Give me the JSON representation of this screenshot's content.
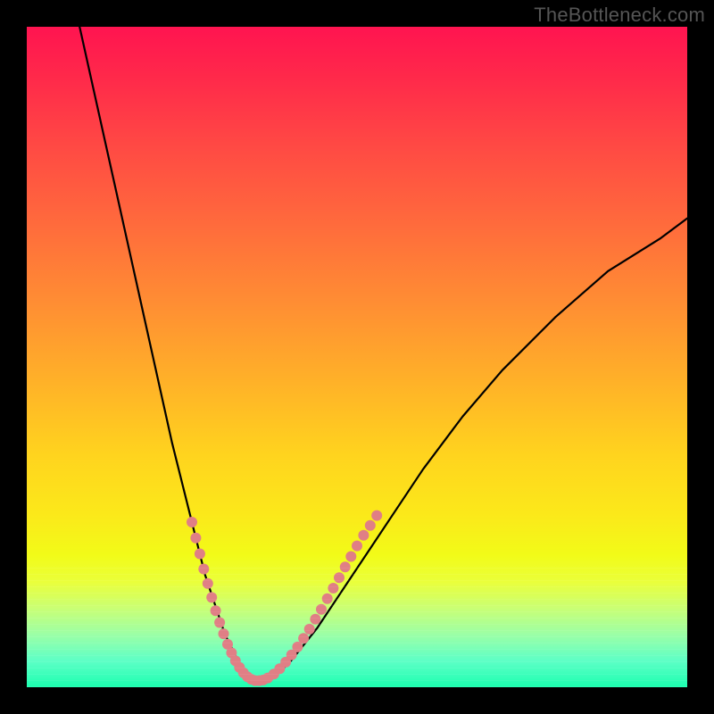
{
  "watermark": {
    "text": "TheBottleneck.com"
  },
  "chart_data": {
    "type": "line",
    "title": "",
    "xlabel": "",
    "ylabel": "",
    "xlim": [
      0,
      100
    ],
    "ylim": [
      0,
      100
    ],
    "grid": false,
    "legend": false,
    "annotations": [],
    "series": [
      {
        "name": "curve",
        "x": [
          8,
          10,
          12,
          14,
          16,
          18,
          20,
          22,
          24,
          26,
          27,
          28,
          29,
          30,
          31,
          32,
          33,
          34,
          35,
          36,
          38,
          40,
          44,
          48,
          52,
          56,
          60,
          66,
          72,
          80,
          88,
          96,
          100
        ],
        "y": [
          100,
          91,
          82,
          73,
          64,
          55,
          46,
          37,
          29,
          21,
          17,
          14,
          11,
          8,
          6,
          4,
          2.5,
          1.5,
          1,
          1,
          2,
          4,
          9,
          15,
          21,
          27,
          33,
          41,
          48,
          56,
          63,
          68,
          71
        ]
      }
    ],
    "markers": {
      "color": "#e07f85",
      "points": [
        {
          "x": 25.0,
          "y": 25.0
        },
        {
          "x": 25.6,
          "y": 22.6
        },
        {
          "x": 26.2,
          "y": 20.2
        },
        {
          "x": 26.8,
          "y": 17.9
        },
        {
          "x": 27.4,
          "y": 15.7
        },
        {
          "x": 28.0,
          "y": 13.6
        },
        {
          "x": 28.6,
          "y": 11.6
        },
        {
          "x": 29.2,
          "y": 9.8
        },
        {
          "x": 29.8,
          "y": 8.1
        },
        {
          "x": 30.4,
          "y": 6.5
        },
        {
          "x": 31.0,
          "y": 5.2
        },
        {
          "x": 31.6,
          "y": 4.0
        },
        {
          "x": 32.2,
          "y": 3.0
        },
        {
          "x": 32.8,
          "y": 2.2
        },
        {
          "x": 33.4,
          "y": 1.6
        },
        {
          "x": 34.0,
          "y": 1.2
        },
        {
          "x": 34.6,
          "y": 1.0
        },
        {
          "x": 35.2,
          "y": 1.0
        },
        {
          "x": 35.8,
          "y": 1.1
        },
        {
          "x": 36.5,
          "y": 1.4
        },
        {
          "x": 37.4,
          "y": 2.0
        },
        {
          "x": 38.3,
          "y": 2.8
        },
        {
          "x": 39.2,
          "y": 3.8
        },
        {
          "x": 40.1,
          "y": 4.9
        },
        {
          "x": 41.0,
          "y": 6.1
        },
        {
          "x": 41.9,
          "y": 7.4
        },
        {
          "x": 42.8,
          "y": 8.8
        },
        {
          "x": 43.7,
          "y": 10.3
        },
        {
          "x": 44.6,
          "y": 11.8
        },
        {
          "x": 45.5,
          "y": 13.4
        },
        {
          "x": 46.4,
          "y": 15.0
        },
        {
          "x": 47.3,
          "y": 16.6
        },
        {
          "x": 48.2,
          "y": 18.2
        },
        {
          "x": 49.1,
          "y": 19.8
        },
        {
          "x": 50.0,
          "y": 21.4
        },
        {
          "x": 51.0,
          "y": 23.0
        },
        {
          "x": 52.0,
          "y": 24.5
        },
        {
          "x": 53.0,
          "y": 26.0
        }
      ]
    }
  }
}
